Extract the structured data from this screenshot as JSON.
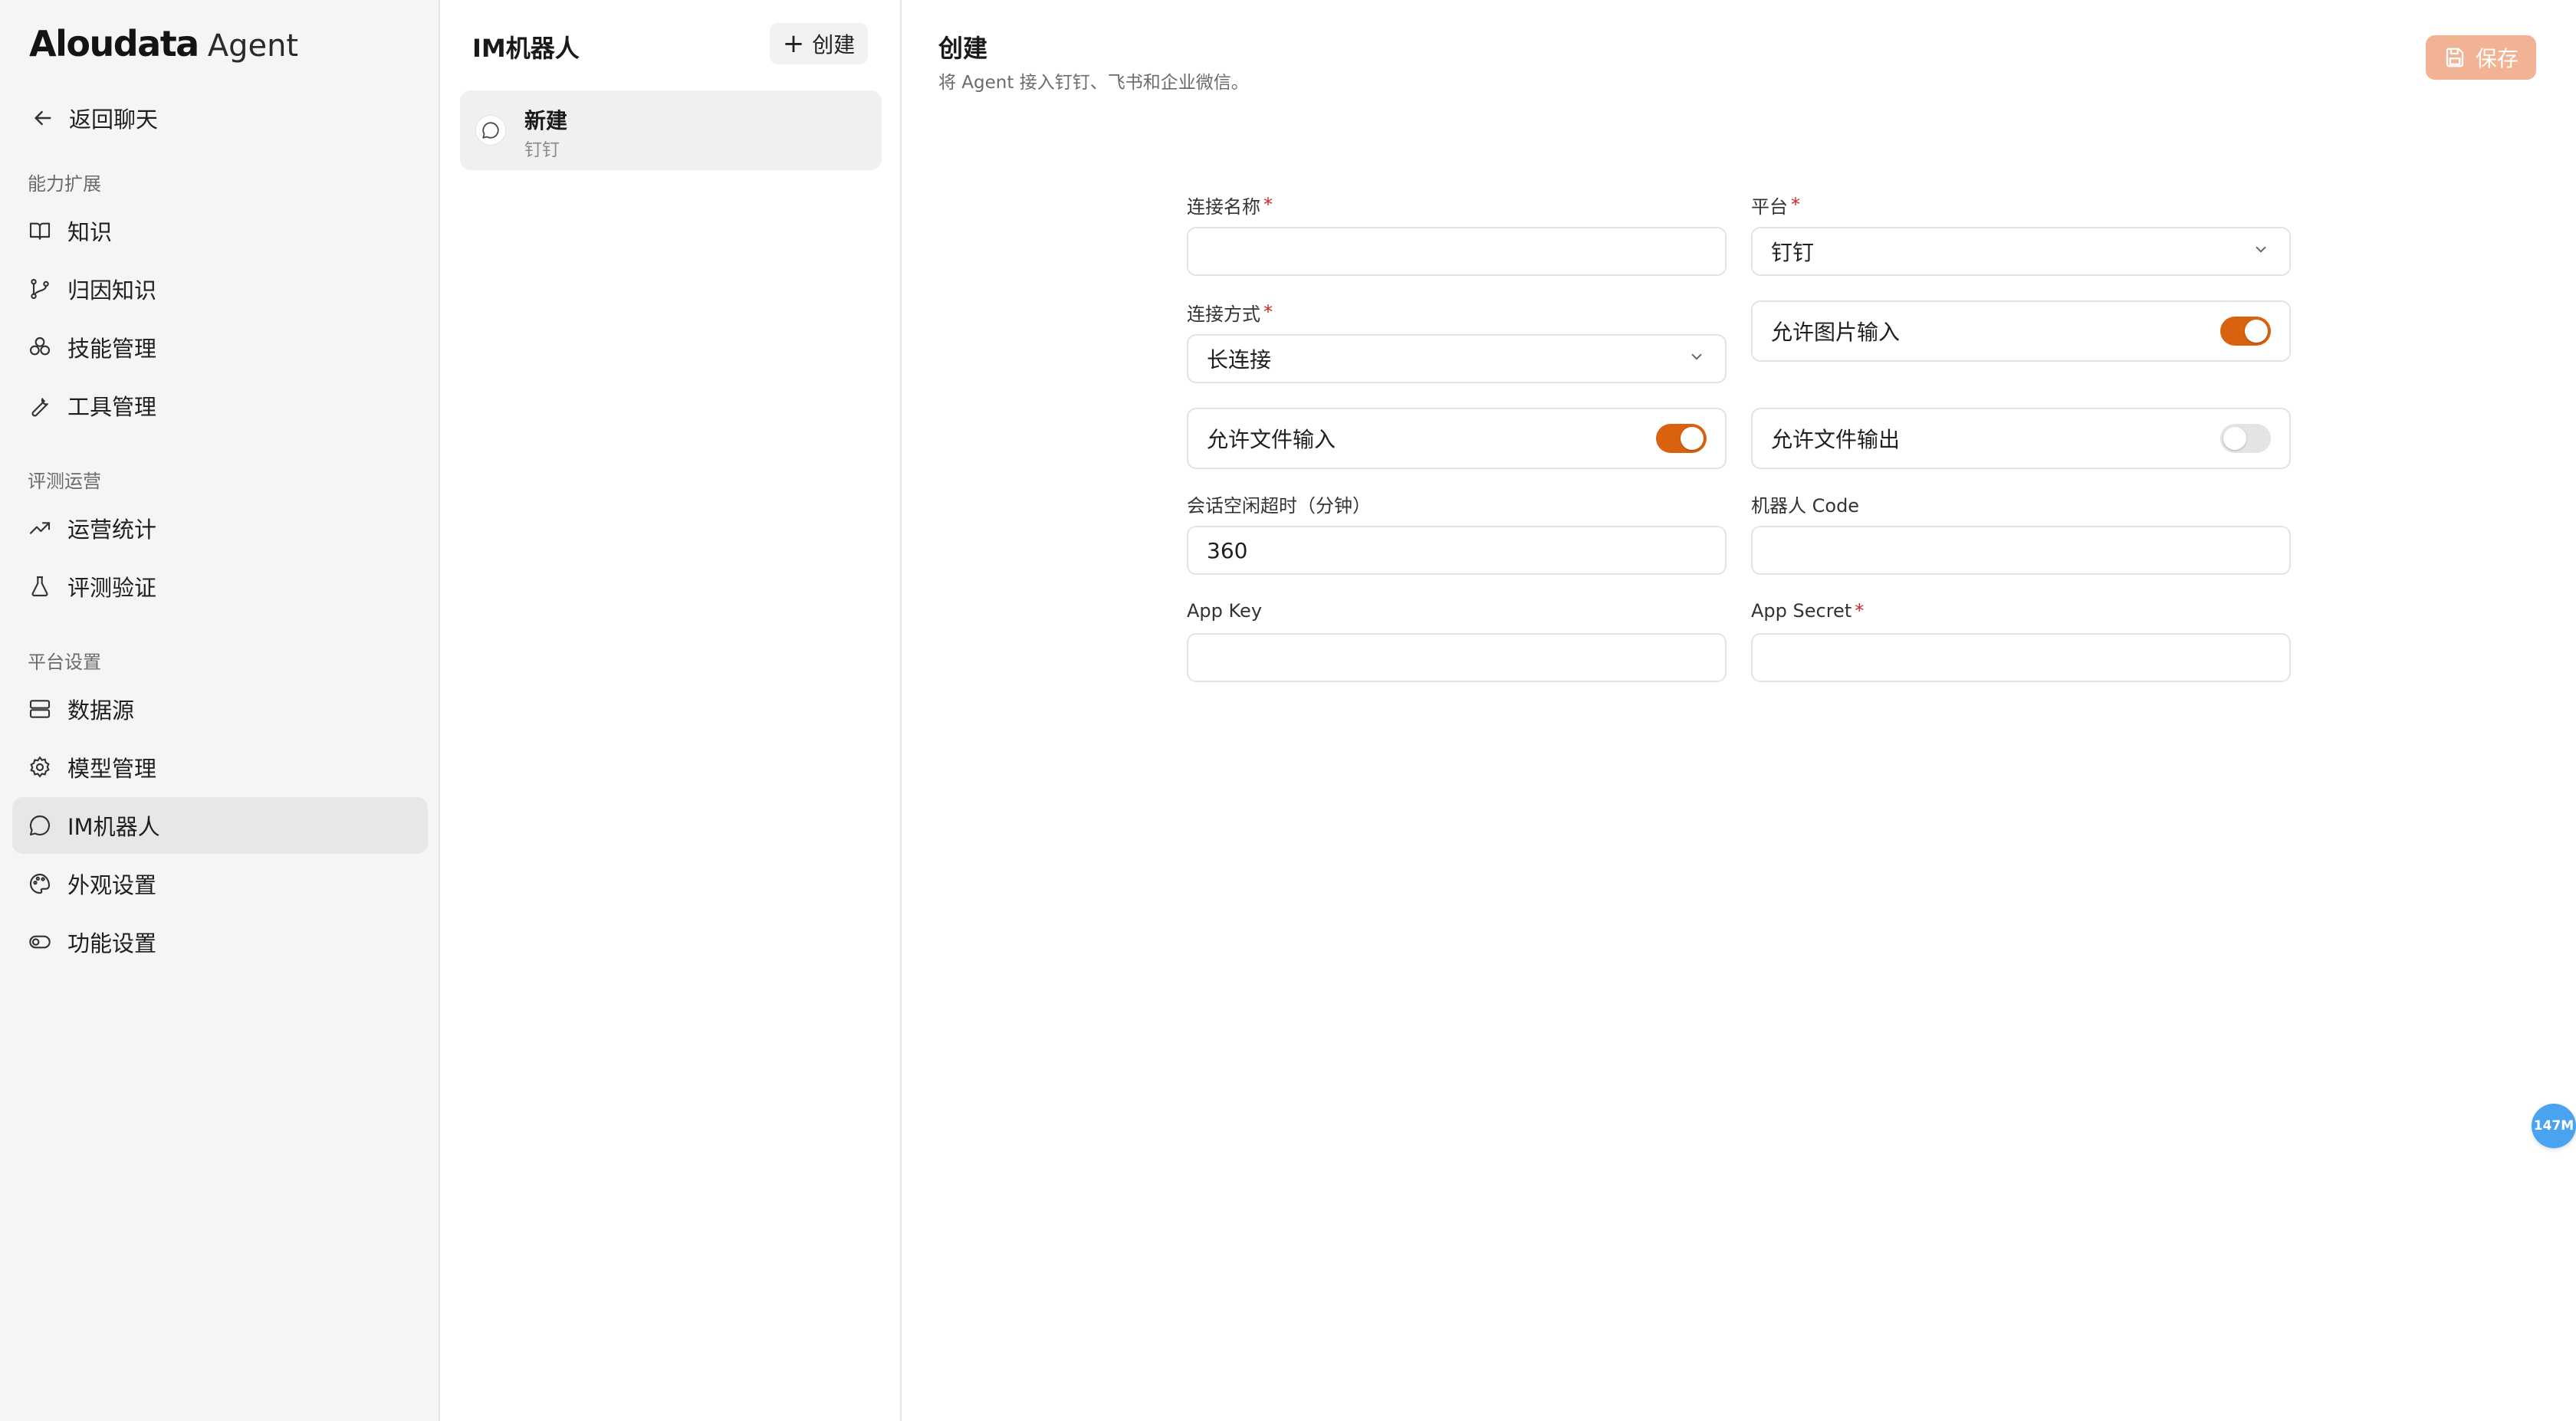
{
  "brand": {
    "name": "Aloudata",
    "product": "Agent"
  },
  "sidebar": {
    "back_label": "返回聊天",
    "sections": [
      {
        "title": "能力扩展",
        "items": [
          {
            "label": "知识",
            "icon": "book-icon"
          },
          {
            "label": "归因知识",
            "icon": "branch-icon"
          },
          {
            "label": "技能管理",
            "icon": "circles-icon"
          },
          {
            "label": "工具管理",
            "icon": "wrench-icon"
          }
        ]
      },
      {
        "title": "评测运营",
        "items": [
          {
            "label": "运营统计",
            "icon": "trend-icon"
          },
          {
            "label": "评测验证",
            "icon": "flask-icon"
          }
        ]
      },
      {
        "title": "平台设置",
        "items": [
          {
            "label": "数据源",
            "icon": "server-icon"
          },
          {
            "label": "模型管理",
            "icon": "gear-icon"
          },
          {
            "label": "IM机器人",
            "icon": "chat-icon",
            "active": true
          },
          {
            "label": "外观设置",
            "icon": "palette-icon"
          },
          {
            "label": "功能设置",
            "icon": "toggle-icon"
          }
        ]
      }
    ]
  },
  "listpanel": {
    "title": "IM机器人",
    "create_label": "创建",
    "items": [
      {
        "name": "新建",
        "platform": "钉钉"
      }
    ]
  },
  "main": {
    "title": "创建",
    "subtitle": "将 Agent 接入钉钉、飞书和企业微信。",
    "save_label": "保存",
    "form": {
      "connection_name": {
        "label": "连接名称",
        "required": true,
        "value": ""
      },
      "platform": {
        "label": "平台",
        "required": true,
        "value": "钉钉"
      },
      "connection_mode": {
        "label": "连接方式",
        "required": true,
        "value": "长连接"
      },
      "allow_image_input": {
        "label": "允许图片输入",
        "on": true
      },
      "allow_file_input": {
        "label": "允许文件输入",
        "on": true
      },
      "allow_file_output": {
        "label": "允许文件输出",
        "on": false
      },
      "idle_timeout": {
        "label": "会话空闲超时（分钟）",
        "value": "360"
      },
      "robot_code": {
        "label": "机器人 Code",
        "value": ""
      },
      "app_key": {
        "label": "App Key",
        "value": ""
      },
      "app_secret": {
        "label": "App Secret",
        "required": true,
        "value": ""
      }
    }
  },
  "float_badge": "147M",
  "colors": {
    "accent": "#d9620f",
    "save_button": "#f2b394",
    "badge": "#4aa3f0",
    "required": "#c9262a"
  }
}
